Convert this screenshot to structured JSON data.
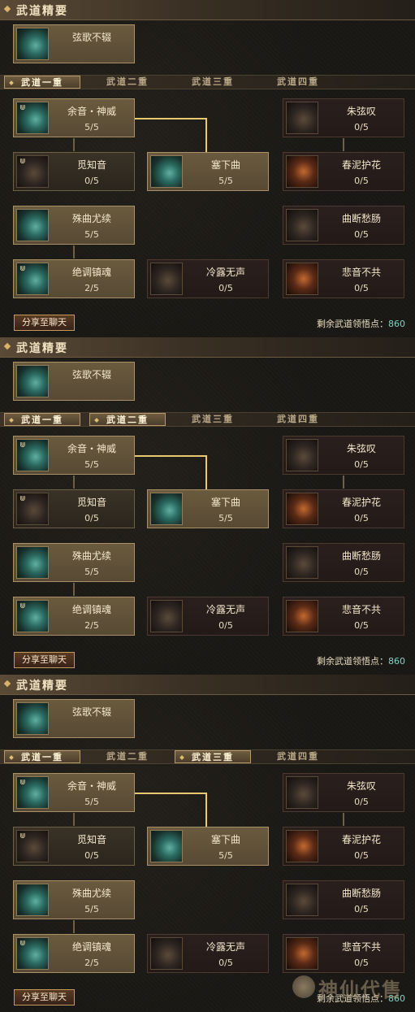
{
  "panels": [
    {
      "header": "武道精要",
      "essence": {
        "name": "弦歌不辍"
      },
      "tabs": [
        "武道一重",
        "武道二重",
        "武道三重",
        "武道四重"
      ],
      "active_tab": 0,
      "skills": {
        "yuyin": {
          "name": "余音・神威",
          "value": "5/5"
        },
        "zhuxian": {
          "name": "朱弦叹",
          "value": "0/5"
        },
        "mizhi": {
          "name": "觅知音",
          "value": "0/5"
        },
        "saixia": {
          "name": "塞下曲",
          "value": "5/5"
        },
        "chunni": {
          "name": "春泥护花",
          "value": "0/5"
        },
        "shuqu": {
          "name": "殊曲尤续",
          "value": "5/5"
        },
        "quduan": {
          "name": "曲断愁肠",
          "value": "0/5"
        },
        "juediao": {
          "name": "绝调镇魂",
          "value": "2/5"
        },
        "lenglu": {
          "name": "冷露无声",
          "value": "0/5"
        },
        "beiyin": {
          "name": "悲音不共",
          "value": "0/5"
        }
      },
      "share_label": "分享至聊天",
      "remain_label": "剩余武道领悟点：",
      "remain_value": "860"
    },
    {
      "header": "武道精要",
      "essence": {
        "name": "弦歌不辍"
      },
      "tabs": [
        "武道一重",
        "武道二重",
        "武道三重",
        "武道四重"
      ],
      "active_tab": 1,
      "skills": {
        "yuyin": {
          "name": "余音・神威",
          "value": "5/5"
        },
        "zhuxian": {
          "name": "朱弦叹",
          "value": "0/5"
        },
        "mizhi": {
          "name": "觅知音",
          "value": "0/5"
        },
        "saixia": {
          "name": "塞下曲",
          "value": "5/5"
        },
        "chunni": {
          "name": "春泥护花",
          "value": "0/5"
        },
        "shuqu": {
          "name": "殊曲尤续",
          "value": "5/5"
        },
        "quduan": {
          "name": "曲断愁肠",
          "value": "0/5"
        },
        "juediao": {
          "name": "绝调镇魂",
          "value": "2/5"
        },
        "lenglu": {
          "name": "冷露无声",
          "value": "0/5"
        },
        "beiyin": {
          "name": "悲音不共",
          "value": "0/5"
        }
      },
      "share_label": "分享至聊天",
      "remain_label": "剩余武道领悟点：",
      "remain_value": "860"
    },
    {
      "header": "武道精要",
      "essence": {
        "name": "弦歌不辍"
      },
      "tabs": [
        "武道一重",
        "武道二重",
        "武道三重",
        "武道四重"
      ],
      "active_tab": 2,
      "skills": {
        "yuyin": {
          "name": "余音・神威",
          "value": "5/5"
        },
        "zhuxian": {
          "name": "朱弦叹",
          "value": "0/5"
        },
        "mizhi": {
          "name": "觅知音",
          "value": "0/5"
        },
        "saixia": {
          "name": "塞下曲",
          "value": "5/5"
        },
        "chunni": {
          "name": "春泥护花",
          "value": "0/5"
        },
        "shuqu": {
          "name": "殊曲尤续",
          "value": "5/5"
        },
        "quduan": {
          "name": "曲断愁肠",
          "value": "0/5"
        },
        "juediao": {
          "name": "绝调镇魂",
          "value": "2/5"
        },
        "lenglu": {
          "name": "冷露无声",
          "value": "0/5"
        },
        "beiyin": {
          "name": "悲音不共",
          "value": "0/5"
        }
      },
      "share_label": "分享至聊天",
      "remain_label": "剩余武道领悟点：",
      "remain_value": "860"
    }
  ],
  "watermark": "神仙代售",
  "colors": {
    "accent_line": "#e8c870",
    "points": "#7fd3c2"
  }
}
